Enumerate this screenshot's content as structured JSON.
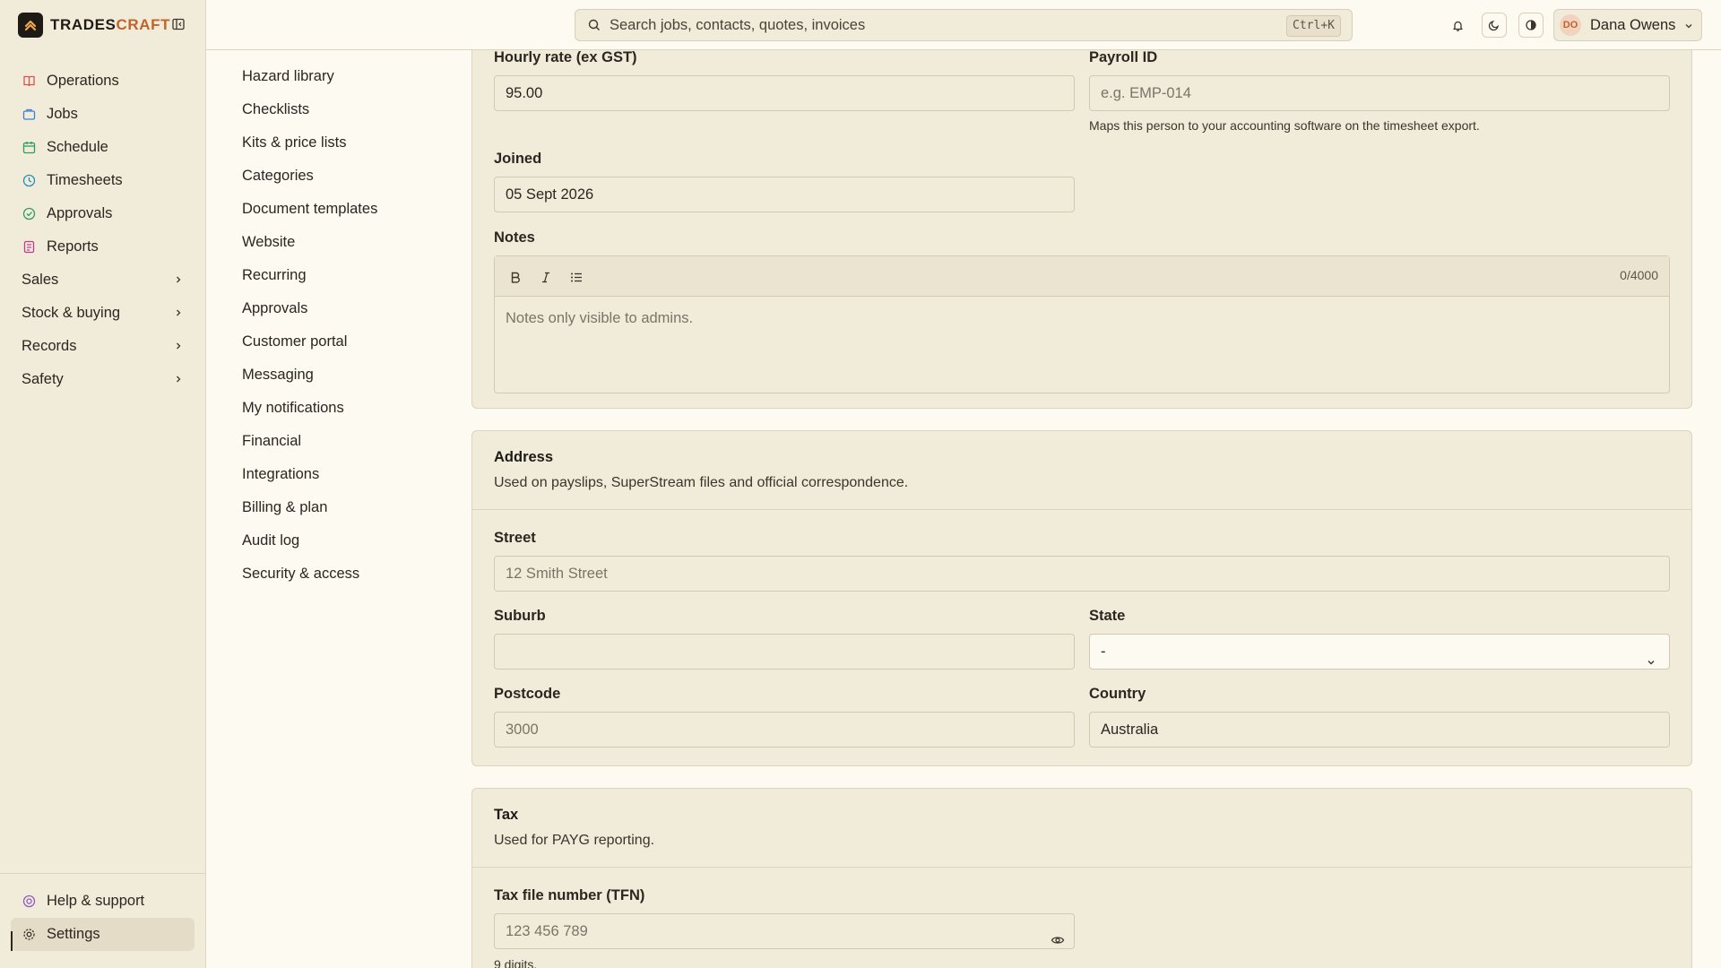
{
  "brand": {
    "name_main": "TRADES",
    "name_accent": "CRAFT"
  },
  "sidebar": {
    "items": [
      {
        "label": "Operations",
        "icon": "book-icon",
        "color": "#d9534f"
      },
      {
        "label": "Jobs",
        "icon": "briefcase-icon",
        "color": "#3b7dd8"
      },
      {
        "label": "Schedule",
        "icon": "calendar-icon",
        "color": "#2e9e5b"
      },
      {
        "label": "Timesheets",
        "icon": "clock-icon",
        "color": "#2b8fb5"
      },
      {
        "label": "Approvals",
        "icon": "check-circle-icon",
        "color": "#2e9e5b"
      },
      {
        "label": "Reports",
        "icon": "report-icon",
        "color": "#c23b8e"
      }
    ],
    "groups": [
      {
        "label": "Sales"
      },
      {
        "label": "Stock & buying"
      },
      {
        "label": "Records"
      },
      {
        "label": "Safety"
      }
    ],
    "bottom": [
      {
        "label": "Help & support",
        "icon": "help-icon",
        "color": "#8e5cc2"
      },
      {
        "label": "Settings",
        "icon": "gear-icon",
        "color": "#3b352c",
        "active": true
      }
    ]
  },
  "subnav": {
    "items": [
      "Hazard library",
      "Checklists",
      "Kits & price lists",
      "Categories",
      "Document templates",
      "Website",
      "Recurring",
      "Approvals",
      "Customer portal",
      "Messaging",
      "My notifications",
      "Financial",
      "Integrations",
      "Billing & plan",
      "Audit log",
      "Security & access"
    ]
  },
  "topbar": {
    "search_placeholder": "Search jobs, contacts, quotes, invoices",
    "shortcut": "Ctrl+K",
    "user_initials": "DO",
    "user_name": "Dana Owens"
  },
  "employment": {
    "hourly_rate_label": "Hourly rate (ex GST)",
    "hourly_rate_value": "95.00",
    "payroll_id_label": "Payroll ID",
    "payroll_id_placeholder": "e.g. EMP-014",
    "payroll_id_hint": "Maps this person to your accounting software on the timesheet export.",
    "joined_label": "Joined",
    "joined_value": "05 Sept 2026",
    "notes_label": "Notes",
    "notes_count": "0/4000",
    "notes_placeholder": "Notes only visible to admins."
  },
  "address": {
    "title": "Address",
    "description": "Used on payslips, SuperStream files and official correspondence.",
    "street_label": "Street",
    "street_placeholder": "12 Smith Street",
    "suburb_label": "Suburb",
    "suburb_value": "",
    "state_label": "State",
    "state_value": "-",
    "postcode_label": "Postcode",
    "postcode_placeholder": "3000",
    "country_label": "Country",
    "country_value": "Australia"
  },
  "tax": {
    "title": "Tax",
    "description": "Used for PAYG reporting.",
    "tfn_label": "Tax file number (TFN)",
    "tfn_placeholder": "123 456 789",
    "tfn_hint": "9 digits."
  }
}
